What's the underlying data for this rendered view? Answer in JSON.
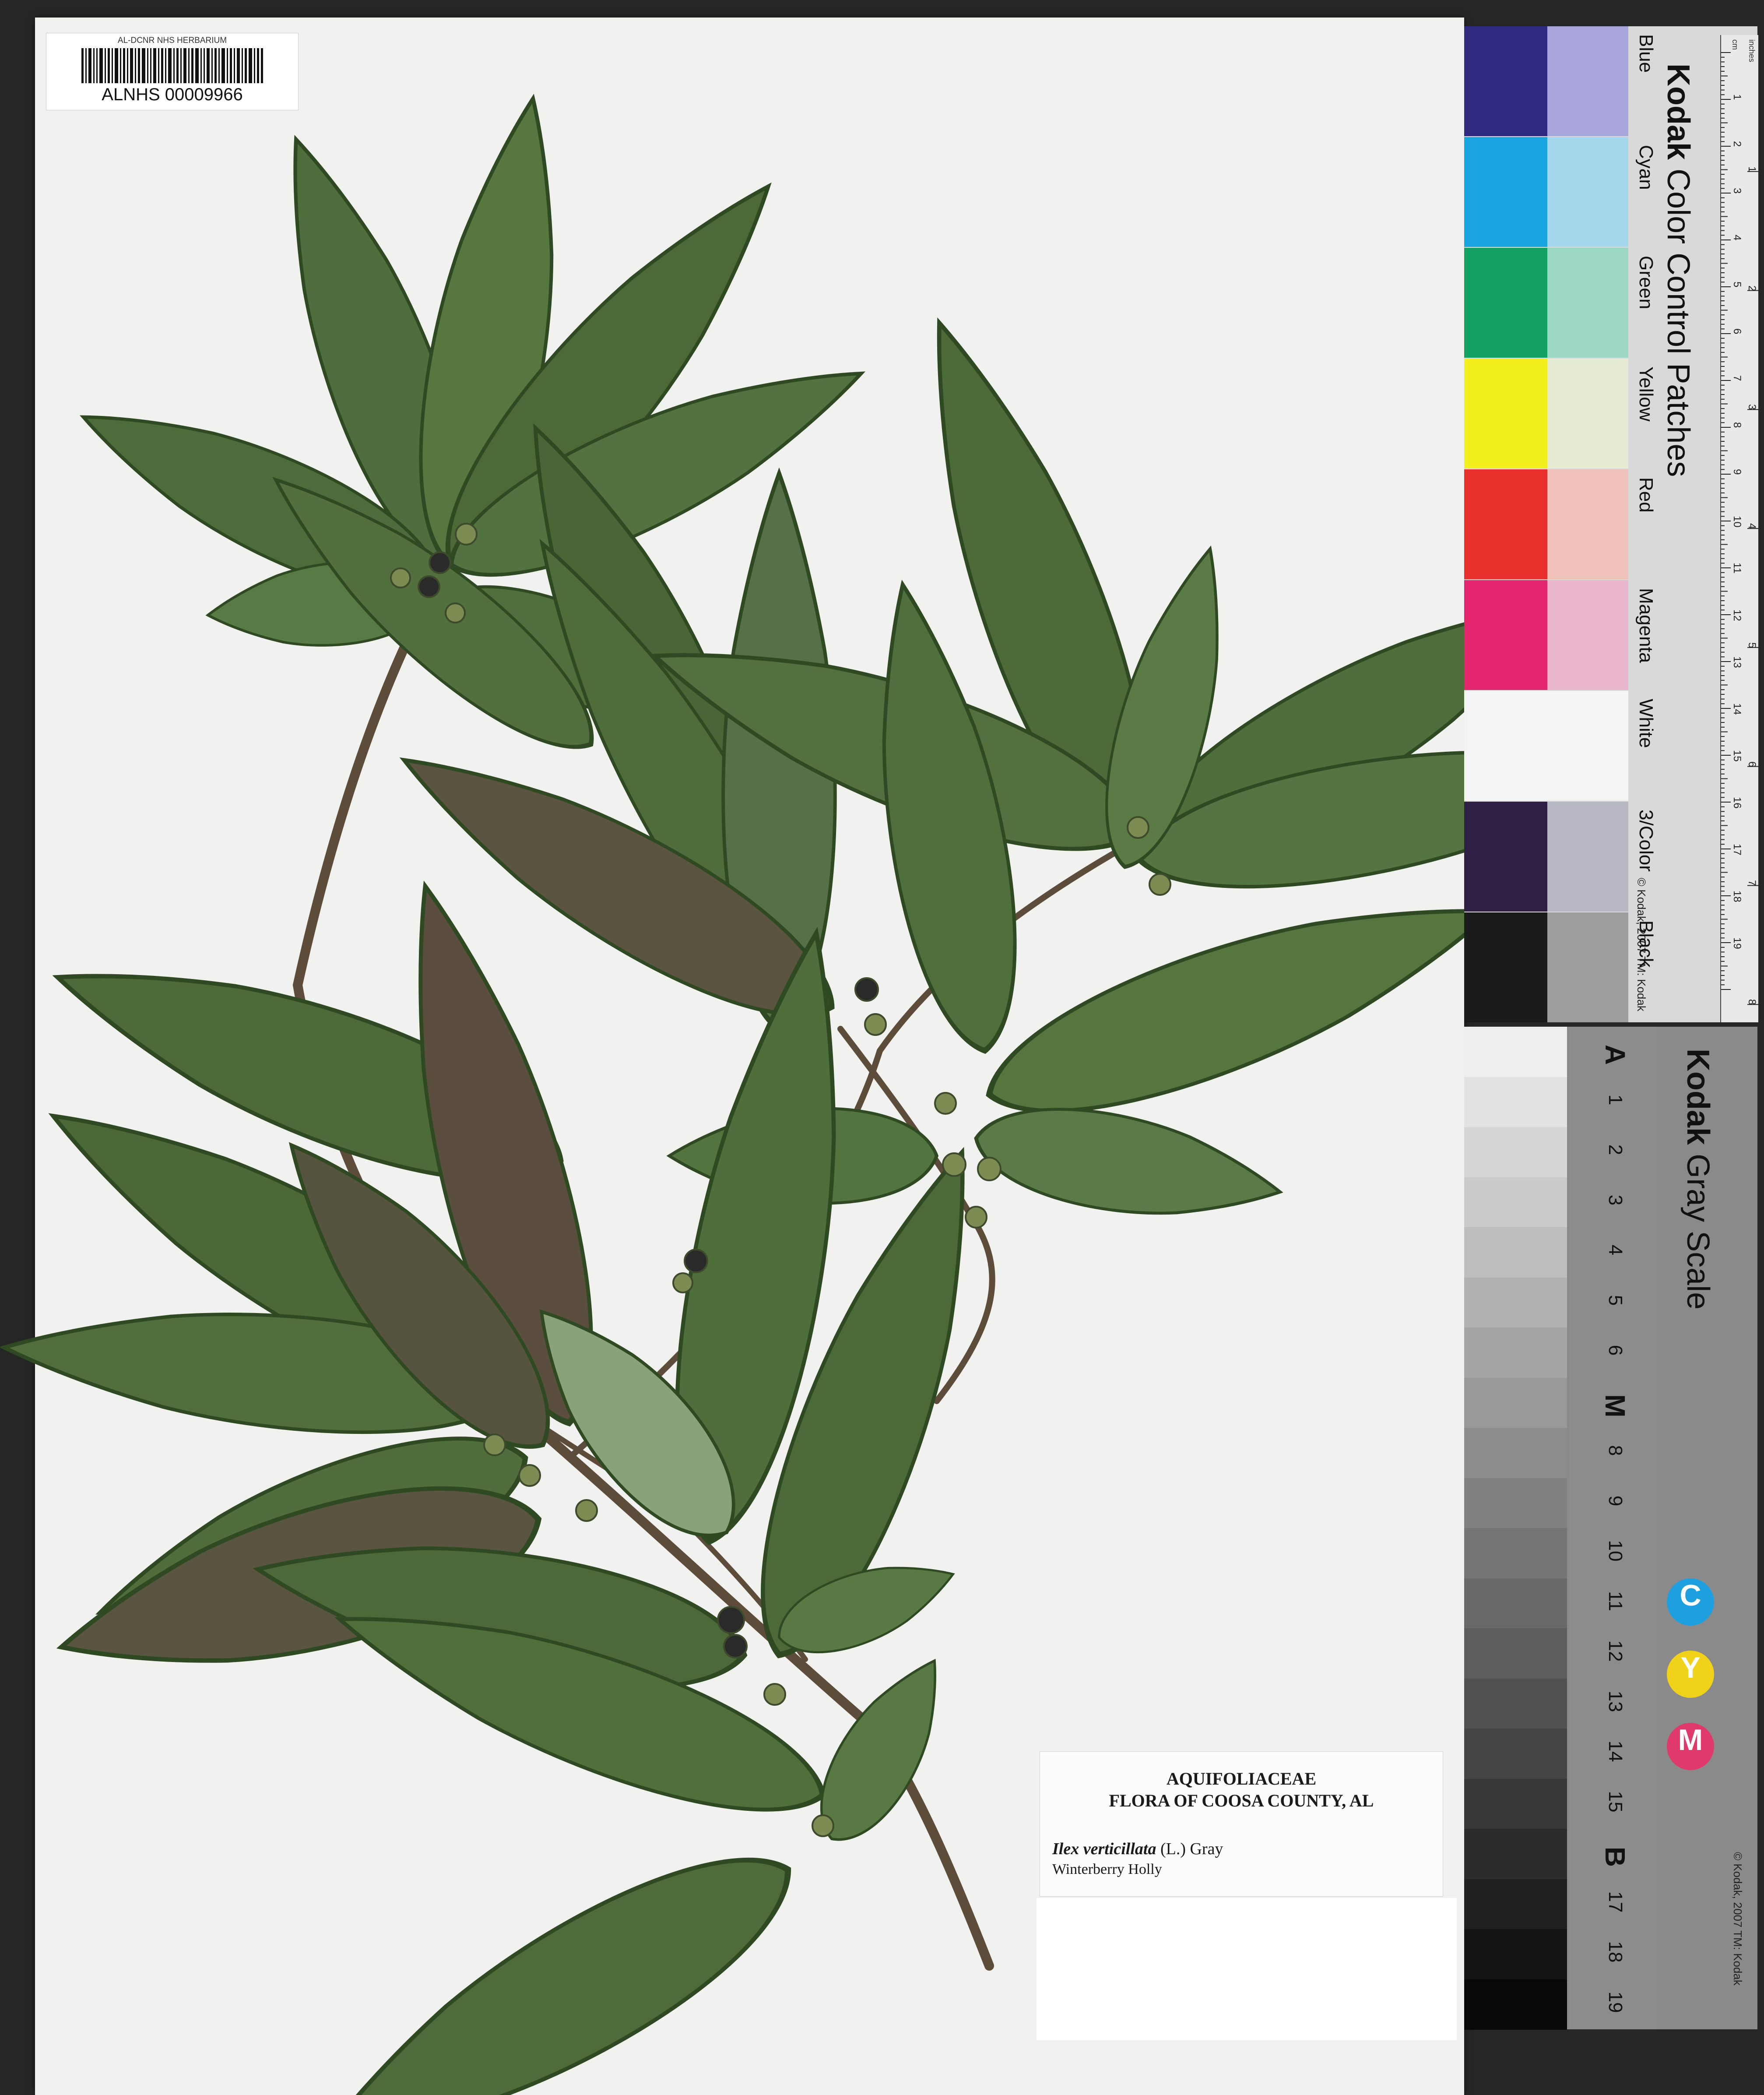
{
  "barcode_label": {
    "institution": "AL-DCNR NHS HERBARIUM",
    "catalog_number": "ALNHS 00009966"
  },
  "herbarium_label": {
    "family": "AQUIFOLIACEAE",
    "flora": "FLORA OF COOSA COUNTY, AL",
    "scientific_name": "Ilex verticillata",
    "author": "(L.) Gray",
    "common_name": "Winterberry Holly"
  },
  "color_card": {
    "title_brand": "Kodak",
    "title_rest": "Color Control Patches",
    "copyright": "© Kodak, 2007 TM: Kodak",
    "ruler_cm_label": "cm",
    "ruler_inch_label": "inches",
    "ruler_cm": [
      "1",
      "2",
      "3",
      "4",
      "5",
      "6",
      "7",
      "8",
      "9",
      "10",
      "11",
      "12",
      "13",
      "14",
      "15",
      "16",
      "17",
      "18",
      "19"
    ],
    "ruler_in": [
      "1",
      "2",
      "3",
      "4",
      "5",
      "6",
      "7",
      "8"
    ],
    "patches": [
      {
        "name": "Blue",
        "dark": "#2e2a80",
        "light": "#a8a6da"
      },
      {
        "name": "Cyan",
        "dark": "#1aa4e0",
        "light": "#a6d7ec"
      },
      {
        "name": "Green",
        "dark": "#12a163",
        "light": "#9cd8c4"
      },
      {
        "name": "Yellow",
        "dark": "#f3ef1c",
        "light": "#e6ecd4"
      },
      {
        "name": "Red",
        "dark": "#e8302c",
        "light": "#f0c1b8"
      },
      {
        "name": "Magenta",
        "dark": "#e3266e",
        "light": "#eab7cf"
      },
      {
        "name": "White",
        "dark": "#f4f4f4",
        "light": "#f4f4f4"
      },
      {
        "name": "3/Color",
        "dark": "#2f1f45",
        "light": "#b8b8c4"
      },
      {
        "name": "Black",
        "dark": "#1b1b1b",
        "light": "#9d9d9d"
      }
    ]
  },
  "gray_card": {
    "title_brand": "Kodak",
    "title_rest": "Gray Scale",
    "copyright": "© Kodak, 2007 TM: Kodak",
    "steps": [
      "A",
      "1",
      "2",
      "3",
      "4",
      "5",
      "6",
      "M",
      "8",
      "9",
      "10",
      "11",
      "12",
      "13",
      "14",
      "15",
      "B",
      "17",
      "18",
      "19"
    ],
    "cym": [
      {
        "letter": "C",
        "color": "#1e9fe0"
      },
      {
        "letter": "Y",
        "color": "#f0d21a"
      },
      {
        "letter": "M",
        "color": "#e03a6c"
      }
    ]
  }
}
